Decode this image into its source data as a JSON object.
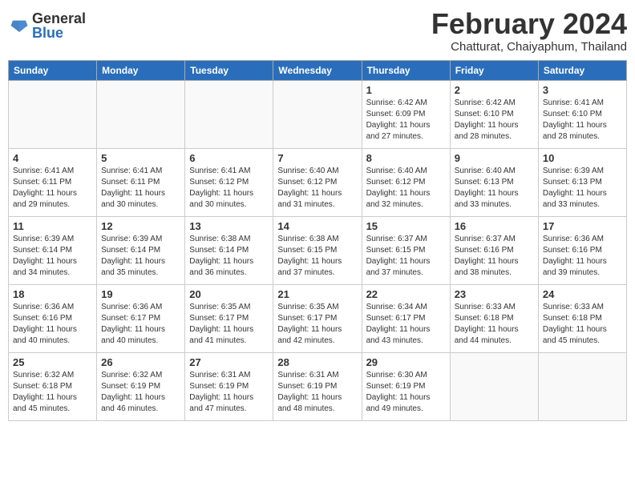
{
  "header": {
    "logo_general": "General",
    "logo_blue": "Blue",
    "month_title": "February 2024",
    "subtitle": "Chatturat, Chaiyaphum, Thailand"
  },
  "weekdays": [
    "Sunday",
    "Monday",
    "Tuesday",
    "Wednesday",
    "Thursday",
    "Friday",
    "Saturday"
  ],
  "weeks": [
    [
      {
        "day": "",
        "info": ""
      },
      {
        "day": "",
        "info": ""
      },
      {
        "day": "",
        "info": ""
      },
      {
        "day": "",
        "info": ""
      },
      {
        "day": "1",
        "info": "Sunrise: 6:42 AM\nSunset: 6:09 PM\nDaylight: 11 hours and 27 minutes."
      },
      {
        "day": "2",
        "info": "Sunrise: 6:42 AM\nSunset: 6:10 PM\nDaylight: 11 hours and 28 minutes."
      },
      {
        "day": "3",
        "info": "Sunrise: 6:41 AM\nSunset: 6:10 PM\nDaylight: 11 hours and 28 minutes."
      }
    ],
    [
      {
        "day": "4",
        "info": "Sunrise: 6:41 AM\nSunset: 6:11 PM\nDaylight: 11 hours and 29 minutes."
      },
      {
        "day": "5",
        "info": "Sunrise: 6:41 AM\nSunset: 6:11 PM\nDaylight: 11 hours and 30 minutes."
      },
      {
        "day": "6",
        "info": "Sunrise: 6:41 AM\nSunset: 6:12 PM\nDaylight: 11 hours and 30 minutes."
      },
      {
        "day": "7",
        "info": "Sunrise: 6:40 AM\nSunset: 6:12 PM\nDaylight: 11 hours and 31 minutes."
      },
      {
        "day": "8",
        "info": "Sunrise: 6:40 AM\nSunset: 6:12 PM\nDaylight: 11 hours and 32 minutes."
      },
      {
        "day": "9",
        "info": "Sunrise: 6:40 AM\nSunset: 6:13 PM\nDaylight: 11 hours and 33 minutes."
      },
      {
        "day": "10",
        "info": "Sunrise: 6:39 AM\nSunset: 6:13 PM\nDaylight: 11 hours and 33 minutes."
      }
    ],
    [
      {
        "day": "11",
        "info": "Sunrise: 6:39 AM\nSunset: 6:14 PM\nDaylight: 11 hours and 34 minutes."
      },
      {
        "day": "12",
        "info": "Sunrise: 6:39 AM\nSunset: 6:14 PM\nDaylight: 11 hours and 35 minutes."
      },
      {
        "day": "13",
        "info": "Sunrise: 6:38 AM\nSunset: 6:14 PM\nDaylight: 11 hours and 36 minutes."
      },
      {
        "day": "14",
        "info": "Sunrise: 6:38 AM\nSunset: 6:15 PM\nDaylight: 11 hours and 37 minutes."
      },
      {
        "day": "15",
        "info": "Sunrise: 6:37 AM\nSunset: 6:15 PM\nDaylight: 11 hours and 37 minutes."
      },
      {
        "day": "16",
        "info": "Sunrise: 6:37 AM\nSunset: 6:16 PM\nDaylight: 11 hours and 38 minutes."
      },
      {
        "day": "17",
        "info": "Sunrise: 6:36 AM\nSunset: 6:16 PM\nDaylight: 11 hours and 39 minutes."
      }
    ],
    [
      {
        "day": "18",
        "info": "Sunrise: 6:36 AM\nSunset: 6:16 PM\nDaylight: 11 hours and 40 minutes."
      },
      {
        "day": "19",
        "info": "Sunrise: 6:36 AM\nSunset: 6:17 PM\nDaylight: 11 hours and 40 minutes."
      },
      {
        "day": "20",
        "info": "Sunrise: 6:35 AM\nSunset: 6:17 PM\nDaylight: 11 hours and 41 minutes."
      },
      {
        "day": "21",
        "info": "Sunrise: 6:35 AM\nSunset: 6:17 PM\nDaylight: 11 hours and 42 minutes."
      },
      {
        "day": "22",
        "info": "Sunrise: 6:34 AM\nSunset: 6:17 PM\nDaylight: 11 hours and 43 minutes."
      },
      {
        "day": "23",
        "info": "Sunrise: 6:33 AM\nSunset: 6:18 PM\nDaylight: 11 hours and 44 minutes."
      },
      {
        "day": "24",
        "info": "Sunrise: 6:33 AM\nSunset: 6:18 PM\nDaylight: 11 hours and 45 minutes."
      }
    ],
    [
      {
        "day": "25",
        "info": "Sunrise: 6:32 AM\nSunset: 6:18 PM\nDaylight: 11 hours and 45 minutes."
      },
      {
        "day": "26",
        "info": "Sunrise: 6:32 AM\nSunset: 6:19 PM\nDaylight: 11 hours and 46 minutes."
      },
      {
        "day": "27",
        "info": "Sunrise: 6:31 AM\nSunset: 6:19 PM\nDaylight: 11 hours and 47 minutes."
      },
      {
        "day": "28",
        "info": "Sunrise: 6:31 AM\nSunset: 6:19 PM\nDaylight: 11 hours and 48 minutes."
      },
      {
        "day": "29",
        "info": "Sunrise: 6:30 AM\nSunset: 6:19 PM\nDaylight: 11 hours and 49 minutes."
      },
      {
        "day": "",
        "info": ""
      },
      {
        "day": "",
        "info": ""
      }
    ]
  ]
}
